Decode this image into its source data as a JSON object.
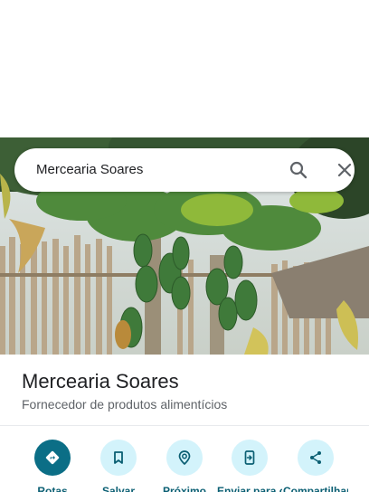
{
  "search": {
    "query": "Mercearia Soares",
    "search_icon": "search-icon",
    "close_icon": "close-icon"
  },
  "place": {
    "title": "Mercearia Soares",
    "category": "Fornecedor de produtos alimentícios",
    "photo_icon": "papaya-tree-photo"
  },
  "actions": [
    {
      "label": "Rotas",
      "icon": "directions-icon"
    },
    {
      "label": "Salvar",
      "icon": "bookmark-icon"
    },
    {
      "label": "Próximo",
      "icon": "nearby-icon"
    },
    {
      "label": "Enviar para o smartphone",
      "icon": "send-to-phone-icon"
    },
    {
      "label": "Compartilhar",
      "icon": "share-icon"
    }
  ],
  "colors": {
    "primary": "#0b6e86",
    "action_bg": "#d3f3fb",
    "action_text": "#0b5f73"
  }
}
